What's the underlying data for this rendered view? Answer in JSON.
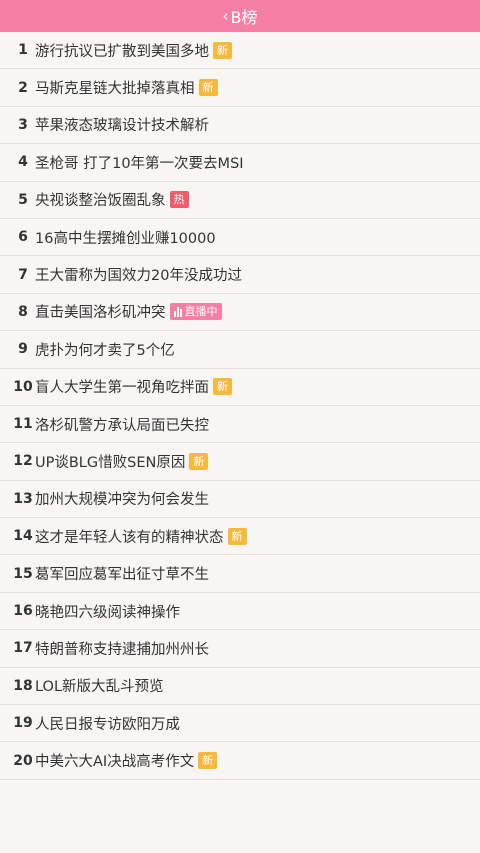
{
  "header": {
    "back_icon": "chevron-left-icon",
    "title": "B榜"
  },
  "items": [
    {
      "rank": "1",
      "title": "游行抗议已扩散到美国多地",
      "badge": "新",
      "badge_type": "new"
    },
    {
      "rank": "2",
      "title": "马斯克星链大批掉落真相",
      "badge": "新",
      "badge_type": "new"
    },
    {
      "rank": "3",
      "title": "苹果液态玻璃设计技术解析",
      "badge": "",
      "badge_type": ""
    },
    {
      "rank": "4",
      "title": "圣枪哥 打了10年第一次要去MSI",
      "badge": "",
      "badge_type": ""
    },
    {
      "rank": "5",
      "title": "央视谈整治饭圈乱象",
      "badge": "热",
      "badge_type": "hot"
    },
    {
      "rank": "6",
      "title": "16高中生摆摊创业赚10000",
      "badge": "",
      "badge_type": ""
    },
    {
      "rank": "7",
      "title": "王大雷称为国效力20年没成功过",
      "badge": "",
      "badge_type": ""
    },
    {
      "rank": "8",
      "title": "直击美国洛杉矶冲突",
      "badge": "直播中",
      "badge_type": "live"
    },
    {
      "rank": "9",
      "title": "虎扑为何才卖了5个亿",
      "badge": "",
      "badge_type": ""
    },
    {
      "rank": "10",
      "title": "盲人大学生第一视角吃拌面",
      "badge": "新",
      "badge_type": "new"
    },
    {
      "rank": "11",
      "title": "洛杉矶警方承认局面已失控",
      "badge": "",
      "badge_type": ""
    },
    {
      "rank": "12",
      "title": "UP谈BLG惜败SEN原因",
      "badge": "新",
      "badge_type": "new"
    },
    {
      "rank": "13",
      "title": "加州大规模冲突为何会发生",
      "badge": "",
      "badge_type": ""
    },
    {
      "rank": "14",
      "title": "这才是年轻人该有的精神状态",
      "badge": "新",
      "badge_type": "new"
    },
    {
      "rank": "15",
      "title": "葛军回应葛军出征寸草不生",
      "badge": "",
      "badge_type": ""
    },
    {
      "rank": "16",
      "title": "晓艳四六级阅读神操作",
      "badge": "",
      "badge_type": ""
    },
    {
      "rank": "17",
      "title": "特朗普称支持逮捕加州州长",
      "badge": "",
      "badge_type": ""
    },
    {
      "rank": "18",
      "title": "LOL新版大乱斗预览",
      "badge": "",
      "badge_type": ""
    },
    {
      "rank": "19",
      "title": "人民日报专访欧阳万成",
      "badge": "",
      "badge_type": ""
    },
    {
      "rank": "20",
      "title": "中美六大AI决战高考作文",
      "badge": "新",
      "badge_type": "new"
    }
  ]
}
